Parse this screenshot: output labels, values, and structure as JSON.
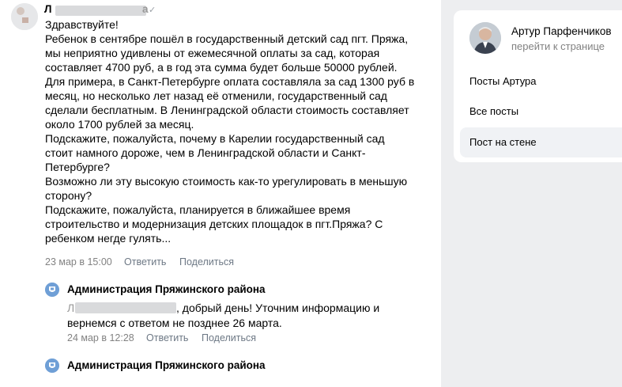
{
  "post": {
    "author_initial": "Л",
    "author_end": "а",
    "verified_icon": "check-icon",
    "lines": [
      "Здравствуйте!",
      "Ребенок в сентябре пошёл в государственный детский сад пгт. Пряжа,",
      "мы неприятно удивлены от ежемесячной оплаты за сад, которая",
      "составляет 4700 руб, а в год эта сумма будет больше 50000 рублей.",
      "Для примера, в Санкт-Петербурге оплата составляла за сад 1300 руб в",
      "месяц, но несколько лет назад её отменили, государственный сад",
      "сделали бесплатным. В  Ленинградской области стоимость составляет",
      "около 1700 рублей за месяц.",
      "Подскажите, пожалуйста, почему в Карелии государственный сад",
      "стоит намного дороже, чем в Ленинградской области и Санкт-",
      "Петербурге?",
      "Возможно ли эту высокую стоимость как-то урегулировать в меньшую",
      "сторону?",
      "Подскажите, пожалуйста, планируется в ближайшее время",
      "строительство и модернизация детских площадок в пгт.Пряжа? С",
      "ребенком негде гулять..."
    ],
    "date": "23 мар в 15:00",
    "reply_label": "Ответить",
    "share_label": "Поделиться"
  },
  "replies": [
    {
      "author": "Администрация Пряжинского района",
      "text_initial": "Л",
      "text_line1_rest": ", добрый день! Уточним информацию и",
      "text_line2": "вернемся с ответом не позднее 26 марта.",
      "date": "24 мар в 12:28",
      "reply_label": "Ответить",
      "share_label": "Поделиться"
    },
    {
      "author": "Администрация Пряжинского района"
    }
  ],
  "sidebar": {
    "profile_name": "Артур Парфенчиков",
    "profile_link": "перейти к странице",
    "menu": [
      {
        "label": "Посты Артура",
        "active": false
      },
      {
        "label": "Все посты",
        "active": false
      },
      {
        "label": "Пост на стене",
        "active": true
      }
    ]
  },
  "colors": {
    "sidebar_bg": "#edeef0",
    "muted_text": "#828282",
    "active_menu": "#f0f2f5"
  }
}
